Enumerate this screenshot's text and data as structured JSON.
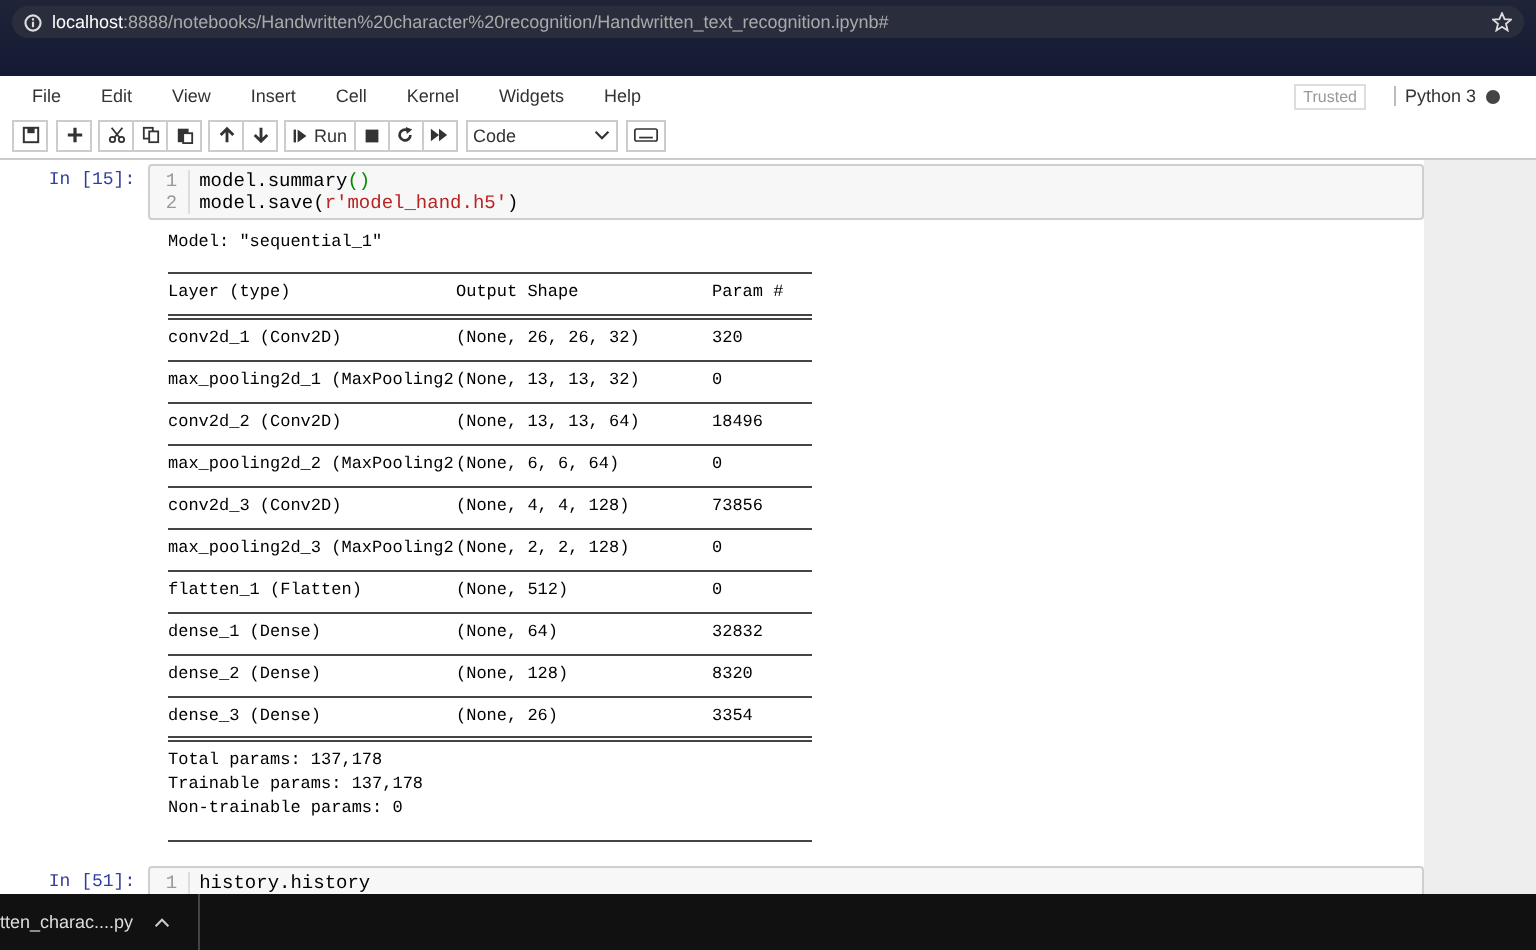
{
  "address_bar": {
    "host": "localhost",
    "path": ":8888/notebooks/Handwritten%20character%20recognition/Handwritten_text_recognition.ipynb#"
  },
  "menu": [
    "File",
    "Edit",
    "View",
    "Insert",
    "Cell",
    "Kernel",
    "Widgets",
    "Help"
  ],
  "notebook_status": {
    "trusted": "Trusted",
    "kernel": "Python 3",
    "kernel_busy": true
  },
  "toolbar": {
    "run_label": "Run",
    "cell_type": "Code"
  },
  "cells": [
    {
      "prompt": "In [15]:",
      "lines": [
        [
          {
            "text": "model.summary",
            "kind": "plain"
          },
          {
            "text": "()",
            "kind": "paren"
          }
        ],
        [
          {
            "text": "model.save(",
            "kind": "plain"
          },
          {
            "text": "r'model_hand.h5'",
            "kind": "string"
          },
          {
            "text": ")",
            "kind": "plain"
          }
        ]
      ],
      "line_numbers": [
        "1",
        "2"
      ],
      "output": {
        "model_line": "Model: \"sequential_1\"",
        "columns": [
          "Layer (type)",
          "Output Shape",
          "Param #"
        ],
        "rows": [
          [
            "conv2d_1 (Conv2D)",
            "(None, 26, 26, 32)",
            "320"
          ],
          [
            "max_pooling2d_1 (MaxPooling2",
            "(None, 13, 13, 32)",
            "0"
          ],
          [
            "conv2d_2 (Conv2D)",
            "(None, 13, 13, 64)",
            "18496"
          ],
          [
            "max_pooling2d_2 (MaxPooling2",
            "(None, 6, 6, 64)",
            "0"
          ],
          [
            "conv2d_3 (Conv2D)",
            "(None, 4, 4, 128)",
            "73856"
          ],
          [
            "max_pooling2d_3 (MaxPooling2",
            "(None, 2, 2, 128)",
            "0"
          ],
          [
            "flatten_1 (Flatten)",
            "(None, 512)",
            "0"
          ],
          [
            "dense_1 (Dense)",
            "(None, 64)",
            "32832"
          ],
          [
            "dense_2 (Dense)",
            "(None, 128)",
            "8320"
          ],
          [
            "dense_3 (Dense)",
            "(None, 26)",
            "3354"
          ]
        ],
        "totals": [
          "Total params: 137,178",
          "Trainable params: 137,178",
          "Non-trainable params: 0"
        ]
      }
    },
    {
      "prompt": "In [51]:",
      "lines": [
        [
          {
            "text": "history.history",
            "kind": "plain"
          }
        ]
      ],
      "line_numbers": [
        "1"
      ]
    }
  ],
  "download_bar": {
    "file": "tten_charac....py"
  }
}
